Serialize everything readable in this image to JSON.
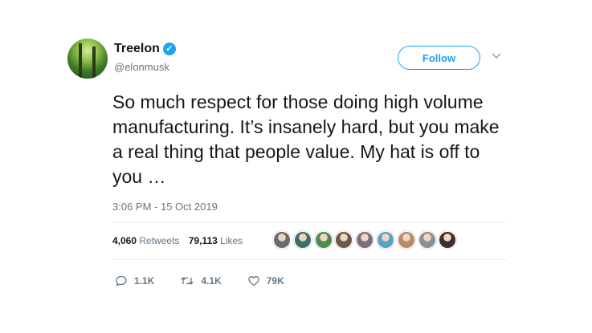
{
  "author": {
    "display_name": "Treelon",
    "handle": "@elonmusk",
    "verified_icon": "verified-badge-icon"
  },
  "follow_label": "Follow",
  "tweet": {
    "text": "So much respect for those doing high volume manufacturing. It’s insanely hard, but you make a real thing that people value. My hat is off to you …",
    "timestamp": "3:06 PM - 15 Oct 2019"
  },
  "stats": {
    "retweets_count": "4,060",
    "retweets_label": "Retweets",
    "likes_count": "79,113",
    "likes_label": "Likes"
  },
  "liker_avatars": [
    "#6b6b6b",
    "#3d6f6a",
    "#4f8a4f",
    "#6e5a4a",
    "#7a6f80",
    "#5da0c7",
    "#b88a6a",
    "#8a8f96",
    "#3a2f2a"
  ],
  "actions": {
    "reply_count": "1.1K",
    "retweet_count": "4.1K",
    "like_count": "79K"
  },
  "colors": {
    "accent": "#1da1f2",
    "secondary_text": "#657786"
  }
}
